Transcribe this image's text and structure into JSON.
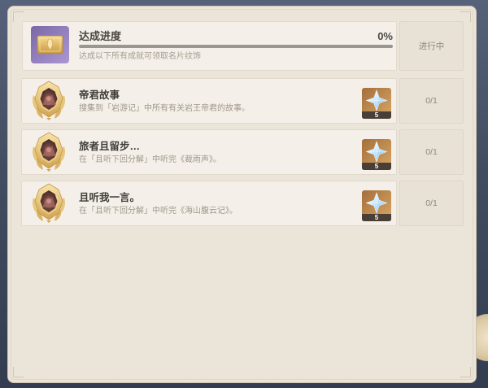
{
  "summary": {
    "icon": "namecard-icon",
    "title": "达成进度",
    "percent_label": "0%",
    "progress": 0,
    "description": "达成以下所有成就可领取名片纹饰",
    "status": "进行中"
  },
  "achievements": [
    {
      "icon": "achievement-medal-icon",
      "title": "帝君故事",
      "description": "搜集到「岩游记」中所有有关岩王帝君的故事。",
      "reward": {
        "icon": "primogem-icon",
        "count": "5"
      },
      "progress": "0/1"
    },
    {
      "icon": "achievement-medal-icon",
      "title": "旅者且留步…",
      "description": "在「且听下回分解」中听完《裁雨声》。",
      "reward": {
        "icon": "primogem-icon",
        "count": "5"
      },
      "progress": "0/1"
    },
    {
      "icon": "achievement-medal-icon",
      "title": "且听我一言。",
      "description": "在「且听下回分解」中听完《海山腹云记》。",
      "reward": {
        "icon": "primogem-icon",
        "count": "5"
      },
      "progress": "0/1"
    }
  ],
  "colors": {
    "panel_background": "#ebe4d9",
    "namecard_background": "#8f7cb9",
    "reward_tile": "#c08a4e",
    "gem": "#bfe4ff",
    "text_primary": "#45423f",
    "text_secondary": "#a39a8e"
  }
}
